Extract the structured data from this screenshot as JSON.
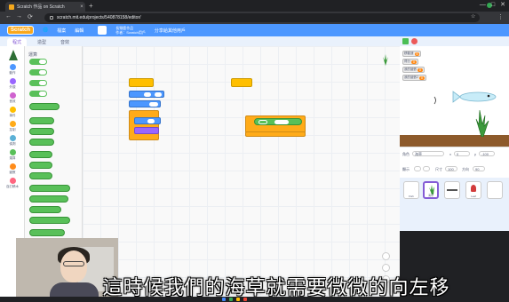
{
  "browser": {
    "tab_title": "Scratch 作品 on Scratch",
    "tab_close": "×",
    "new_tab": "+",
    "url": "scratch.mit.edu/projects/540878158/editor/",
    "window_controls": [
      "—",
      "□",
      "✕"
    ],
    "nav": {
      "back": "←",
      "forward": "→",
      "reload": "⟳"
    },
    "menu": "⋮",
    "star": "☆"
  },
  "menubar": {
    "logo": "Scratch",
    "items": [
      "🌐",
      "檔案",
      "編輯"
    ],
    "project_title": "長頸鹿作品",
    "project_sub1": "作者：Scratch用戶",
    "share": "分享給其他用戶"
  },
  "tabs": [
    "程式",
    "造型",
    "音效"
  ],
  "categories": [
    {
      "label": "動作",
      "color": "#4c97ff"
    },
    {
      "label": "外觀",
      "color": "#9966ff"
    },
    {
      "label": "音效",
      "color": "#cf63cf"
    },
    {
      "label": "事件",
      "color": "#ffbf00"
    },
    {
      "label": "控制",
      "color": "#ffab19"
    },
    {
      "label": "偵測",
      "color": "#5cb1d6"
    },
    {
      "label": "運算",
      "color": "#59c059"
    },
    {
      "label": "變數",
      "color": "#ff8c1a"
    },
    {
      "label": "自訂積木",
      "color": "#ff6680"
    }
  ],
  "palette": {
    "heading": "運算"
  },
  "stage": {
    "variables": [
      {
        "name": "移動速",
        "value": "5"
      },
      {
        "name": "得分",
        "value": "0"
      },
      {
        "name": "我的變數",
        "value": "0"
      },
      {
        "name": "我的變數2",
        "value": "0"
      }
    ]
  },
  "sprite_info": {
    "sprite_label": "角色",
    "sprite_name": "海草",
    "x_label": "x",
    "y_label": "y",
    "x_value": "0",
    "y_value": "-100",
    "show_label": "顯示",
    "size_label": "尺寸",
    "size_value": "100",
    "direction_label": "方向",
    "direction_value": "90"
  },
  "sprites": [
    "Fish",
    "海草",
    "",
    "Leaf"
  ],
  "subtitle": "這時候我們的海草就需要微微的向左移"
}
